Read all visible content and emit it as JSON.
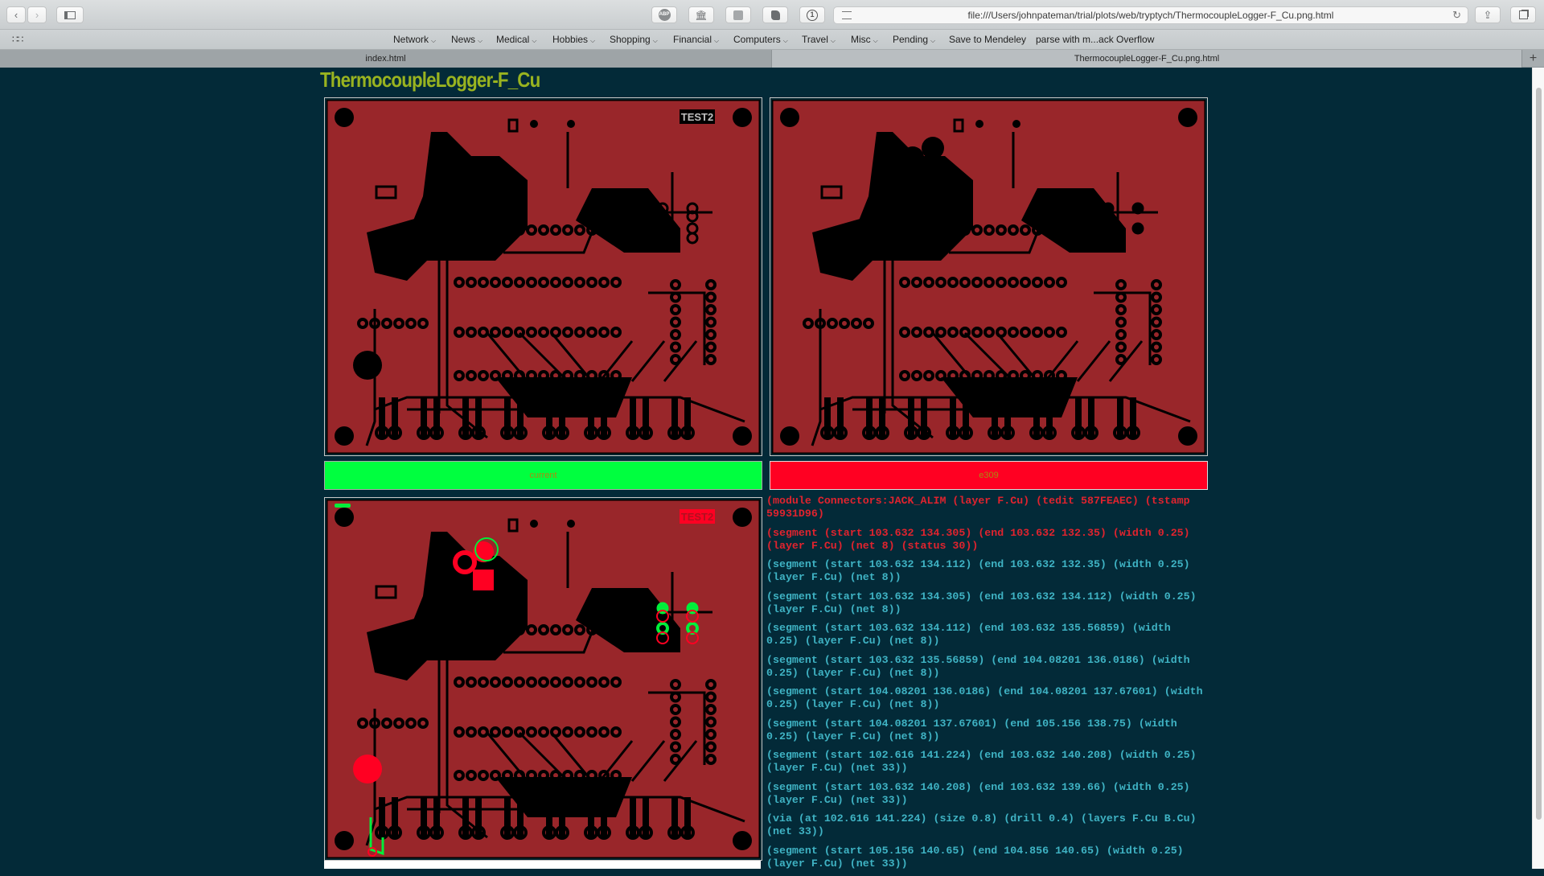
{
  "browser": {
    "url": "file:///Users/johnpateman/trial/plots/web/tryptych/ThermocoupleLogger-F_Cu.png.html",
    "toolbar_icons": [
      "back-icon",
      "forward-icon",
      "sidebar-icon",
      "adblock-icon",
      "library-icon",
      "extension-icon",
      "evernote-icon",
      "onepassword-icon",
      "reader-icon",
      "reload-icon",
      "share-icon",
      "tabs-overview-icon"
    ],
    "adblock_label": "ABP",
    "bookmarks": [
      {
        "label": "Network",
        "dropdown": true
      },
      {
        "label": "News",
        "dropdown": true
      },
      {
        "label": "Medical",
        "dropdown": true
      },
      {
        "label": "Hobbies",
        "dropdown": true
      },
      {
        "label": "Shopping",
        "dropdown": true
      },
      {
        "label": "Financial",
        "dropdown": true
      },
      {
        "label": "Computers",
        "dropdown": true
      },
      {
        "label": "Travel",
        "dropdown": true
      },
      {
        "label": "Misc",
        "dropdown": true
      },
      {
        "label": "Pending",
        "dropdown": true
      },
      {
        "label": "Save to Mendeley",
        "dropdown": false
      },
      {
        "label": "parse with m...ack Overflow",
        "dropdown": false
      }
    ],
    "tabs": [
      {
        "label": "index.html",
        "active": false
      },
      {
        "label": "ThermocoupleLogger-F_Cu.png.html",
        "active": true
      }
    ],
    "new_tab_label": "+"
  },
  "page": {
    "title": "ThermocoupleLogger-F_Cu",
    "panels": [
      {
        "id": "current",
        "label": "TEST2",
        "status": "current",
        "status_color": "#00ff3f"
      },
      {
        "id": "e309",
        "label": "",
        "status": "e309",
        "status_color": "#ff0022"
      },
      {
        "id": "diff",
        "label": "TEST2",
        "status": "",
        "status_color": ""
      }
    ],
    "colors": {
      "board": "#99262a",
      "copper": "#000000",
      "added": "#00ee3a",
      "removed": "#ff0022",
      "title": "#99b320",
      "text_normal": "#3fb3c4",
      "text_highlight": "#e0232e"
    },
    "diff_lines": [
      {
        "text": "(module Connectors:JACK_ALIM (layer F.Cu) (tedit 587FEAEC) (tstamp 59931D96)",
        "highlight": true
      },
      {
        "text": "(segment (start 103.632 134.305) (end 103.632 132.35) (width 0.25) (layer F.Cu) (net 8) (status 30))",
        "highlight": true
      },
      {
        "text": "(segment (start 103.632 134.112) (end 103.632 132.35) (width 0.25) (layer F.Cu) (net 8))",
        "highlight": false
      },
      {
        "text": "(segment (start 103.632 134.305) (end 103.632 134.112) (width 0.25) (layer F.Cu) (net 8))",
        "highlight": false
      },
      {
        "text": "(segment (start 103.632 134.112) (end 103.632 135.56859) (width 0.25) (layer F.Cu) (net 8))",
        "highlight": false
      },
      {
        "text": "(segment (start 103.632 135.56859) (end 104.08201 136.0186) (width 0.25) (layer F.Cu) (net 8))",
        "highlight": false
      },
      {
        "text": "(segment (start 104.08201 136.0186) (end 104.08201 137.67601) (width 0.25) (layer F.Cu) (net 8))",
        "highlight": false
      },
      {
        "text": "(segment (start 104.08201 137.67601) (end 105.156 138.75) (width 0.25) (layer F.Cu) (net 8))",
        "highlight": false
      },
      {
        "text": "(segment (start 102.616 141.224) (end 103.632 140.208) (width 0.25) (layer F.Cu) (net 33))",
        "highlight": false
      },
      {
        "text": "(segment (start 103.632 140.208) (end 103.632 139.66) (width 0.25) (layer F.Cu) (net 33))",
        "highlight": false
      },
      {
        "text": "(via (at 102.616 141.224) (size 0.8) (drill 0.4) (layers F.Cu B.Cu) (net 33))",
        "highlight": false
      },
      {
        "text": "(segment (start 105.156 140.65) (end 104.856 140.65) (width 0.25) (layer F.Cu) (net 33))",
        "highlight": false
      }
    ]
  }
}
